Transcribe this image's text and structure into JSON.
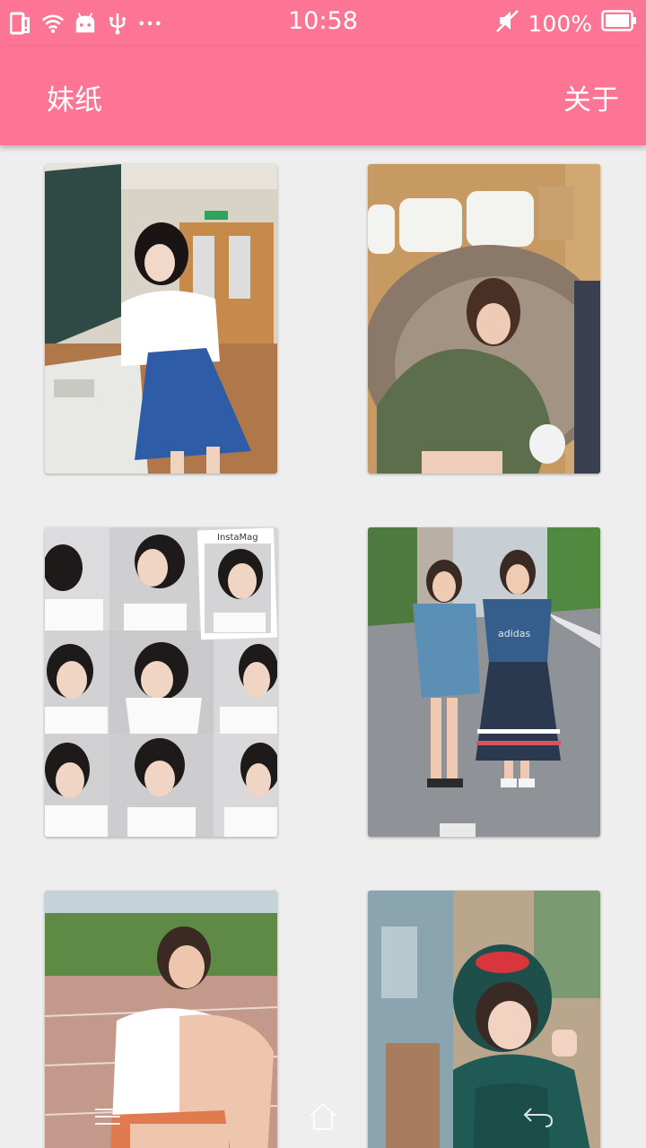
{
  "status_bar": {
    "time": "10:58",
    "battery": "100%",
    "left_icons": [
      "sim-alert-icon",
      "wifi-icon",
      "android-icon",
      "usb-icon",
      "more-dots-icon"
    ],
    "right_icons": [
      "mute-icon",
      "battery-icon"
    ]
  },
  "app_bar": {
    "title": "妹纸",
    "about_label": "关于",
    "color": "#fd7594"
  },
  "photos": [
    {
      "name": "photo-card-1",
      "caption_in_image": ""
    },
    {
      "name": "photo-card-2",
      "caption_in_image": ""
    },
    {
      "name": "photo-card-3",
      "caption_in_image": "InstaMag"
    },
    {
      "name": "photo-card-4",
      "caption_in_image": "adidas"
    },
    {
      "name": "photo-card-5",
      "caption_in_image": ""
    },
    {
      "name": "photo-card-6",
      "caption_in_image": ""
    }
  ],
  "nav_bar": {
    "buttons": [
      "menu-icon",
      "home-icon",
      "back-icon"
    ]
  }
}
